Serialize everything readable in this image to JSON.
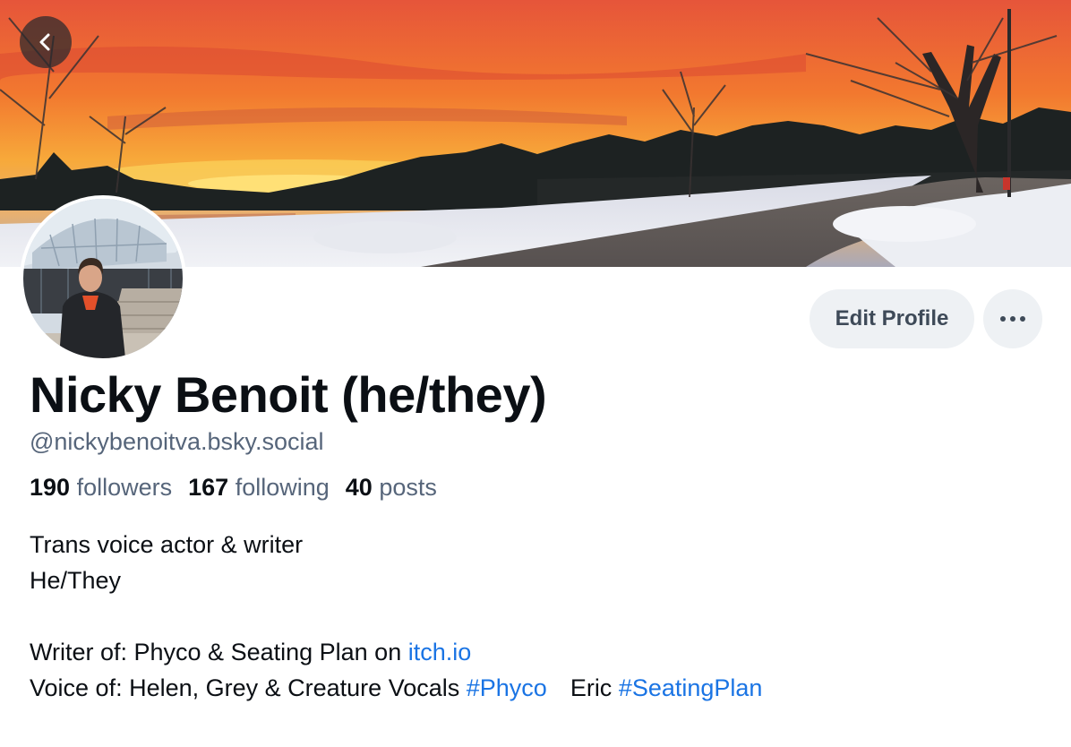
{
  "profile": {
    "display_name": "Nicky Benoit (he/they)",
    "handle": "@nickybenoitva.bsky.social",
    "stats": {
      "followers_count": "190",
      "followers_label": "followers",
      "following_count": "167",
      "following_label": "following",
      "posts_count": "40",
      "posts_label": "posts"
    },
    "bio": {
      "line1": "Trans voice actor & writer",
      "line2": "He/They",
      "line4_prefix": "Writer of: Phyco & Seating Plan on ",
      "line4_link": "itch.io",
      "line5_prefix": "Voice of: Helen, Grey & Creature Vocals ",
      "line5_tag1": "#Phyco",
      "line5_mid": "Eric ",
      "line5_tag2": "#SeatingPlan"
    }
  },
  "actions": {
    "edit_profile_label": "Edit Profile",
    "more_icon": "ellipsis-icon",
    "back_icon": "chevron-left-icon"
  },
  "colors": {
    "link": "#1a74e4",
    "muted_text": "#56657a",
    "button_bg": "#eef1f4"
  }
}
